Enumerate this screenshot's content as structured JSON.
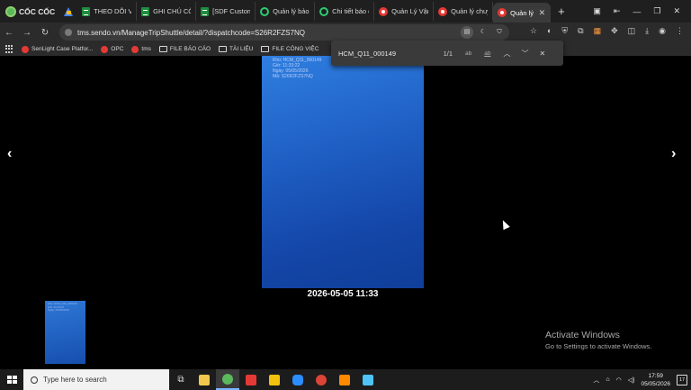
{
  "browser": {
    "brand": "CỐC CỐC",
    "tabs": [
      {
        "label": "THEO DÕI V",
        "icon": "sheets-icon"
      },
      {
        "label": "GHI CHÚ CỐ",
        "icon": "sheets-icon"
      },
      {
        "label": "[SDF Custom",
        "icon": "sheets-icon"
      },
      {
        "label": "Quản lý bảo",
        "icon": "green-circle-icon"
      },
      {
        "label": "Chi tiết báo c",
        "icon": "green-circle-icon"
      },
      {
        "label": "Quản Lý Vận",
        "icon": "tms-icon"
      },
      {
        "label": "Quản lý chuy",
        "icon": "tms-icon"
      },
      {
        "label": "Quản lý",
        "icon": "tms-icon",
        "active": true
      }
    ],
    "url": "tms.sendo.vn/ManageTripShuttle/detail/?dispatchcode=S26R2FZS7NQ",
    "bookmarks": [
      "SenLight Case Platfor...",
      "OPC",
      "tms",
      "FILE BÁO CÁO",
      "TÀI LIỆU",
      "FILE CÔNG VIỆC"
    ]
  },
  "find": {
    "query": "HCM_Q11_000149",
    "count": "1/1",
    "opt_case": "ab",
    "opt_word": "ab"
  },
  "viewer": {
    "prev_glyph": "‹",
    "next_glyph": "›",
    "caption": "2026-05-05 11:33",
    "photo_text": [
      "Kho: HCM_Q11_000149",
      "Giờ: 11:33:22",
      "Ngày: 05/05/2026",
      "Mã: S26R2FZS7NQ"
    ]
  },
  "activation": {
    "title": "Activate Windows",
    "subtitle": "Go to Settings to activate Windows."
  },
  "taskbar": {
    "search_placeholder": "Type here to search",
    "time": "17:59",
    "date": "05/05/2026",
    "notifications": "17"
  },
  "colors": {
    "accent": "#7db6ff",
    "photo_top": "#2f7fe0",
    "photo_bottom": "#0f3f9a"
  }
}
